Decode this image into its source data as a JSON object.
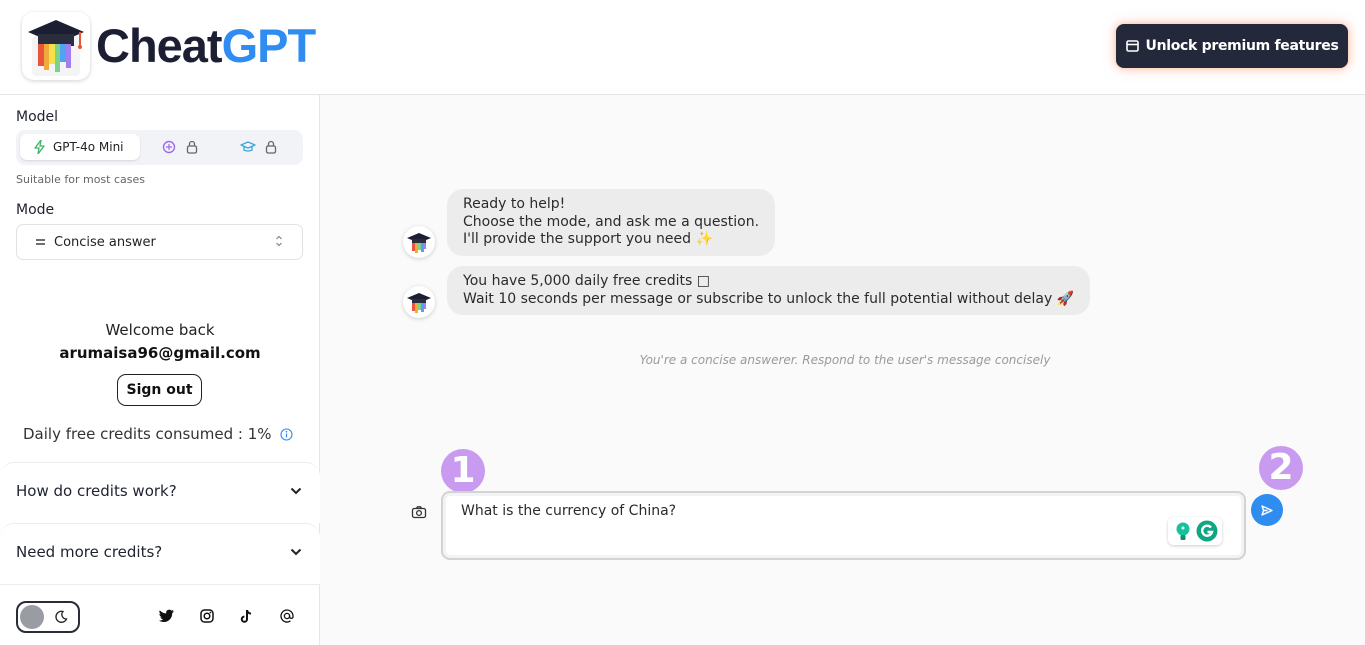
{
  "header": {
    "brand_part1": "Cheat",
    "brand_part2": "GPT",
    "premium_label": "Unlock premium features"
  },
  "sidebar": {
    "model_label": "Model",
    "model_selected": "GPT-4o Mini",
    "model_hint": "Suitable for most cases",
    "mode_label": "Mode",
    "mode_selected": "Concise answer",
    "welcome": "Welcome back",
    "email": "arumaisa96@gmail.com",
    "sign_out": "Sign out",
    "credits_consumed": "Daily free credits consumed : 1%",
    "faq": [
      {
        "title": "How do credits work?"
      },
      {
        "title": "Need more credits?"
      }
    ]
  },
  "chat": {
    "messages": [
      {
        "lines": [
          "Ready to help!",
          "Choose the mode, and ask me a question.",
          "I'll provide the support you need ✨"
        ]
      },
      {
        "lines": [
          "You have 5,000 daily free credits □",
          "Wait 10 seconds per message or subscribe to unlock the full potential without delay 🚀"
        ]
      }
    ],
    "system_note": "You're a concise answerer. Respond to the user's message concisely",
    "input_value": "What is the currency of China?"
  },
  "annotations": {
    "badge1": "1",
    "badge2": "2"
  },
  "colors": {
    "brand_dark": "#1c1f33",
    "brand_blue": "#2f8df2",
    "premium_bg": "#23283a",
    "badge": "#c89af0",
    "bubble": "#ececec"
  }
}
